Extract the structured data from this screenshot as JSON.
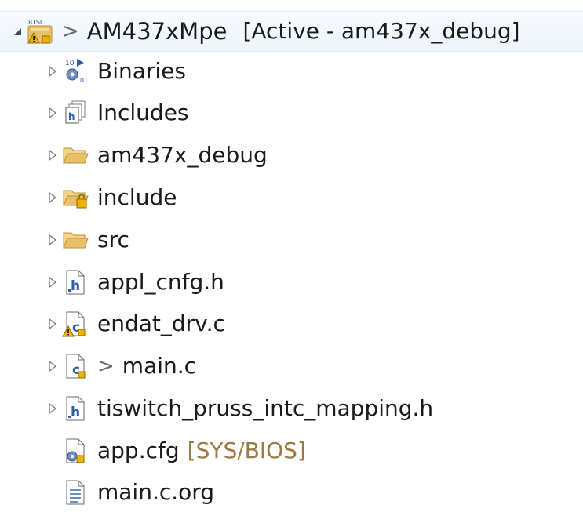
{
  "tree": {
    "root": {
      "prefix": ">",
      "name": "AM437xMpe",
      "decoration": "[Active - am437x_debug]",
      "icon": "ccs-project-warning-icon",
      "badge": "RTSC",
      "expanded": true
    },
    "items": [
      {
        "name": "Binaries",
        "icon": "binaries-icon",
        "expandable": true
      },
      {
        "name": "Includes",
        "icon": "includes-icon",
        "expandable": true
      },
      {
        "name": "am437x_debug",
        "icon": "folder-open-icon",
        "expandable": true
      },
      {
        "name": "include",
        "icon": "folder-locked-icon",
        "expandable": true
      },
      {
        "name": "src",
        "icon": "folder-open-icon",
        "expandable": true
      },
      {
        "name": "appl_cnfg.h",
        "icon": "header-file-icon",
        "expandable": true
      },
      {
        "name": "endat_drv.c",
        "icon": "c-file-warning-icon",
        "expandable": true
      },
      {
        "prefix": ">",
        "name": "main.c",
        "icon": "c-file-icon",
        "expandable": true
      },
      {
        "name": "tiswitch_pruss_intc_mapping.h",
        "icon": "header-file-icon",
        "expandable": true
      },
      {
        "name": "app.cfg",
        "decoration": "[SYS/BIOS]",
        "icon": "config-file-icon",
        "expandable": false
      },
      {
        "name": "main.c.org",
        "icon": "text-file-icon",
        "expandable": false
      }
    ]
  },
  "colors": {
    "selection_bg": "#eef4fb",
    "decoration_text": "#9a7b43",
    "folder": "#e8c06a",
    "file_blue": "#2f5fa8",
    "warning": "#f0b400"
  }
}
